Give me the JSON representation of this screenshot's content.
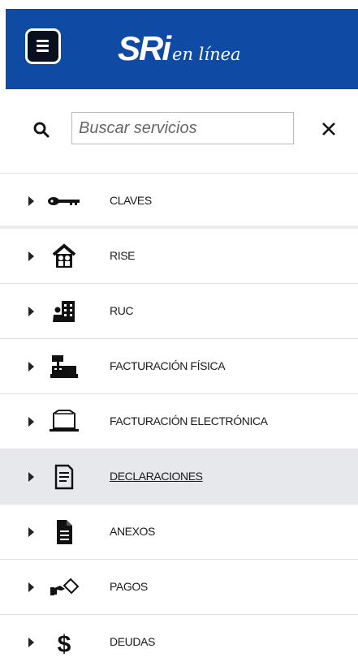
{
  "header": {
    "brand": "SRi",
    "brand_sub": "en línea",
    "color": "#0f4aa5"
  },
  "search": {
    "placeholder": "Buscar servicios",
    "value": ""
  },
  "menu": {
    "items": [
      {
        "label": "CLAVES",
        "icon": "key-icon"
      },
      {
        "label": "RISE",
        "icon": "house-people-icon"
      },
      {
        "label": "RUC",
        "icon": "building-person-icon"
      },
      {
        "label": "FACTURACIÓN FÍSICA",
        "icon": "cash-register-icon"
      },
      {
        "label": "FACTURACIÓN ELECTRÓNICA",
        "icon": "laptop-icon"
      },
      {
        "label": "DECLARACIONES",
        "icon": "document-lines-icon",
        "active": true
      },
      {
        "label": "ANEXOS",
        "icon": "file-icon"
      },
      {
        "label": "PAGOS",
        "icon": "hand-card-icon"
      },
      {
        "label": "DEUDAS",
        "icon": "dollar-icon"
      }
    ]
  }
}
